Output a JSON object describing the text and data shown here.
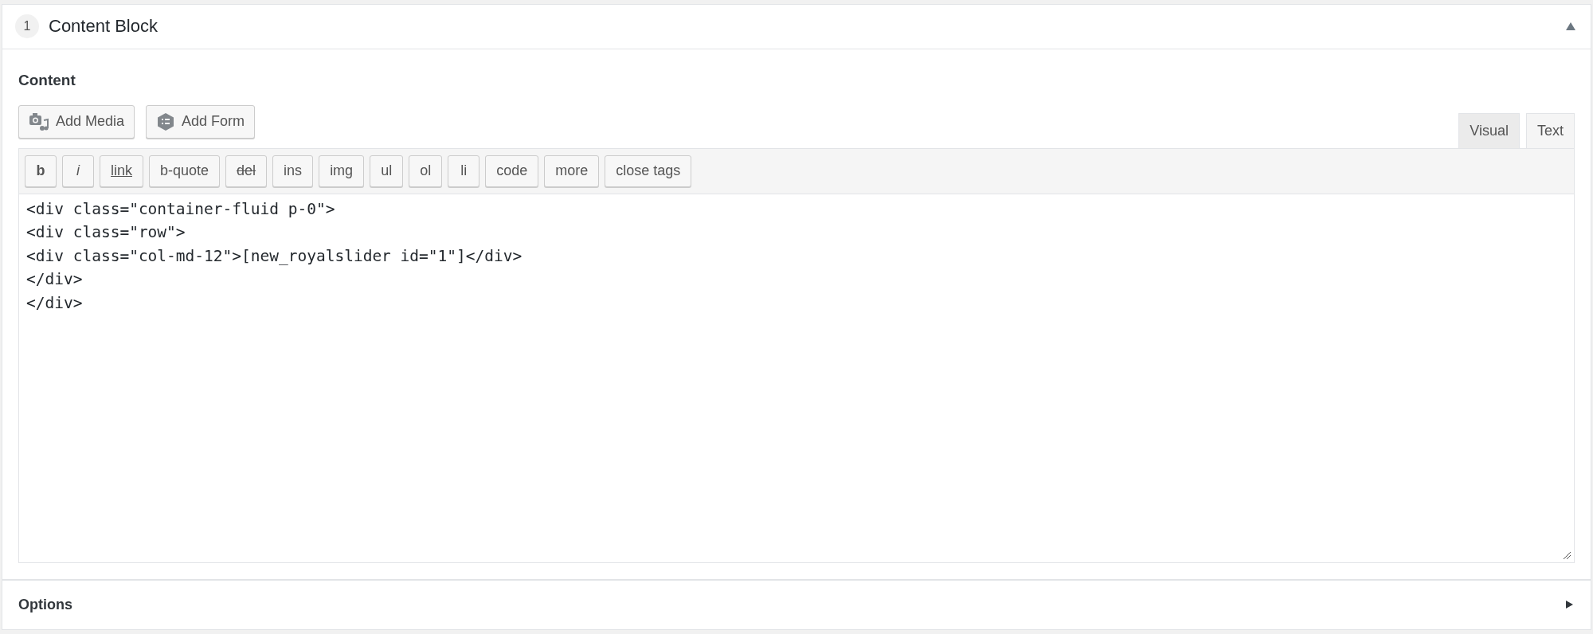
{
  "sections": [
    {
      "kind": "content",
      "number": "1",
      "title": "Content Block",
      "expanded": true,
      "field_label": "Content",
      "media_buttons": [
        {
          "label": "Add Media",
          "kind": "media"
        },
        {
          "label": "Add Form",
          "kind": "form"
        }
      ],
      "tabs": [
        {
          "label": "Visual",
          "selected": false
        },
        {
          "label": "Text",
          "selected": true
        }
      ],
      "toolbar": [
        {
          "label": "b",
          "kind": "bold"
        },
        {
          "label": "i",
          "kind": "italic"
        },
        {
          "label": "link",
          "kind": "underline"
        },
        {
          "label": "b-quote",
          "kind": "plain"
        },
        {
          "label": "del",
          "kind": "strike"
        },
        {
          "label": "ins",
          "kind": "plain"
        },
        {
          "label": "img",
          "kind": "plain"
        },
        {
          "label": "ul",
          "kind": "plain"
        },
        {
          "label": "ol",
          "kind": "plain"
        },
        {
          "label": "li",
          "kind": "plain"
        },
        {
          "label": "code",
          "kind": "plain"
        },
        {
          "label": "more",
          "kind": "plain"
        },
        {
          "label": "close tags",
          "kind": "plain"
        }
      ],
      "editor_text": "<div class=\"container-fluid p-0\">\n<div class=\"row\">\n<div class=\"col-md-12\">[new_royalslider id=\"1\"]</div>\n</div>\n</div>"
    },
    {
      "kind": "options",
      "title": "Options",
      "expanded": false
    }
  ]
}
